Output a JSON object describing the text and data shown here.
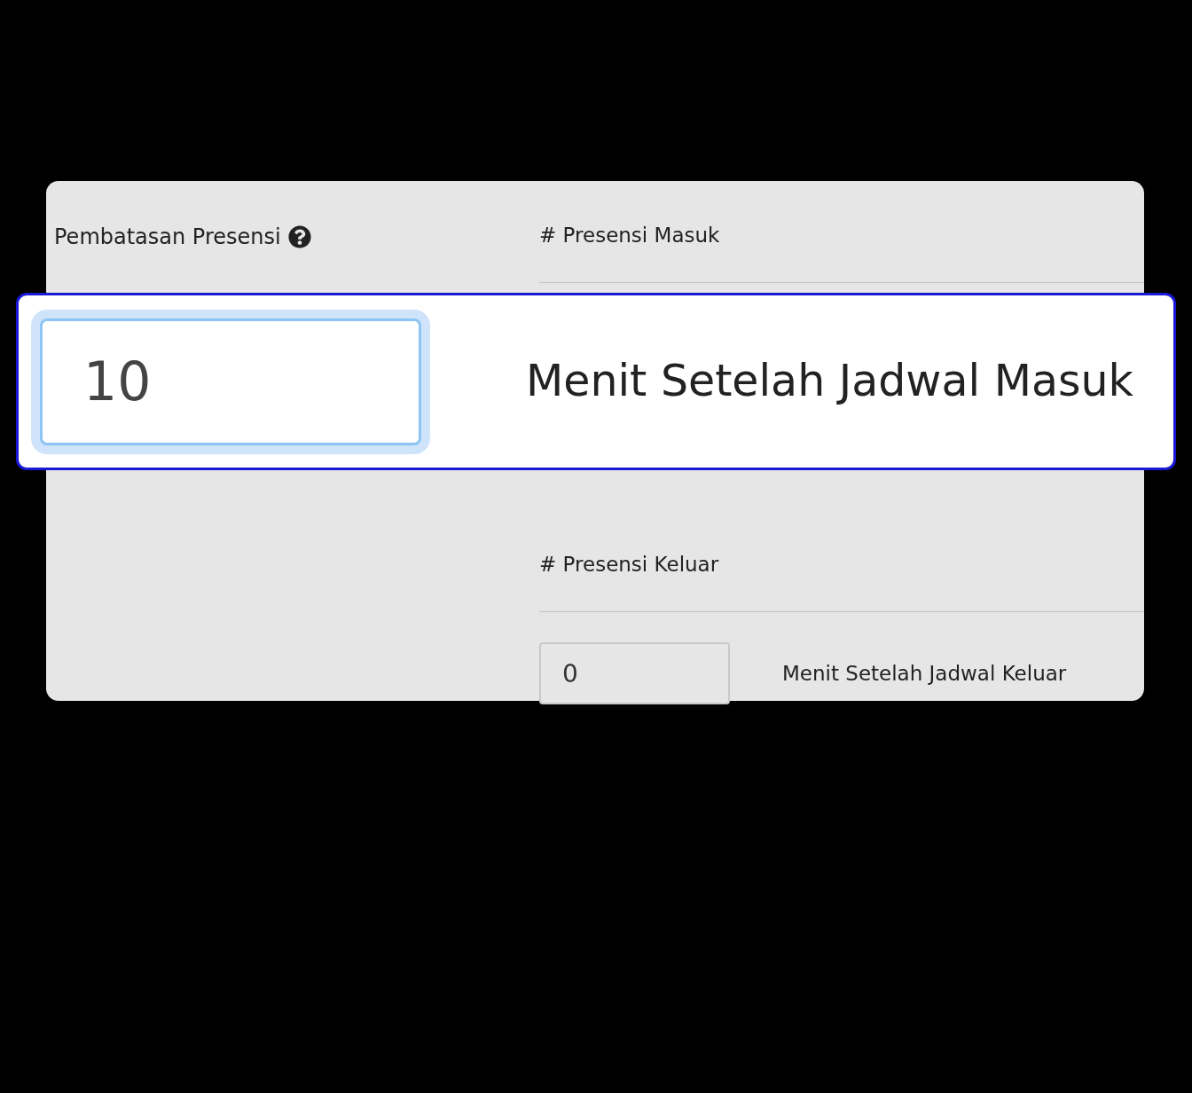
{
  "restriction": {
    "label": "Pembatasan Presensi"
  },
  "sections": [
    {
      "heading": "# Presensi Masuk",
      "value": "10",
      "suffix": "Menit Setelah Jadwal Masuk",
      "highlighted": true
    },
    {
      "heading": "# Presensi Keluar",
      "value": "0",
      "suffix": "Menit Setelah Jadwal Keluar",
      "highlighted": false
    }
  ]
}
